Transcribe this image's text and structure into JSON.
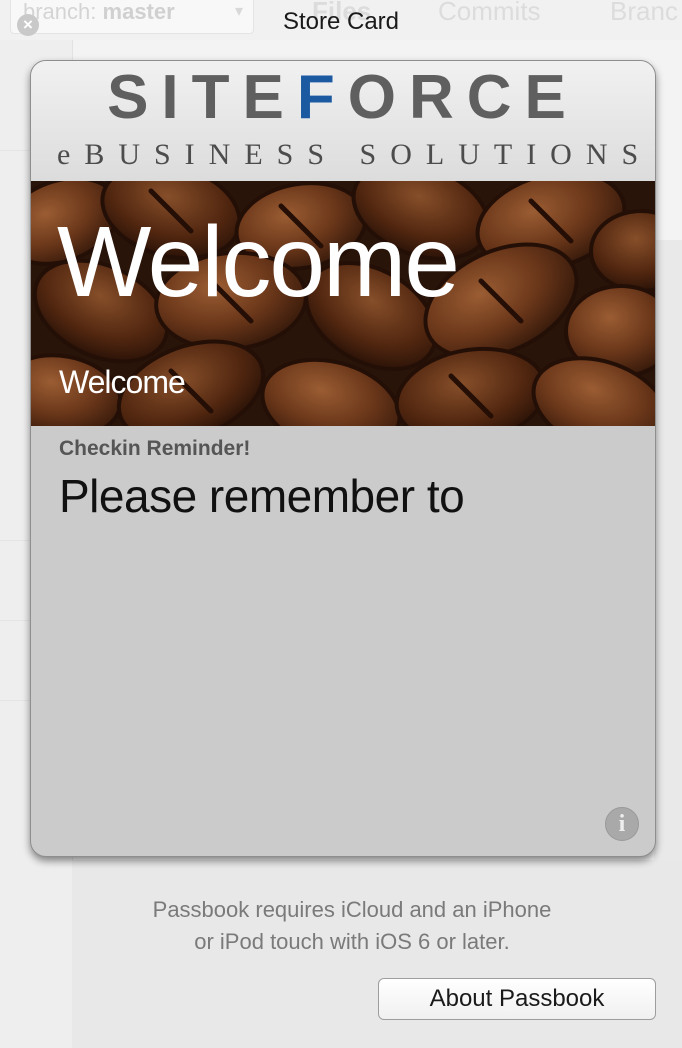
{
  "window": {
    "title": "Store Card",
    "close_icon": "close-icon"
  },
  "background_window": {
    "branch_label": "branch:",
    "branch_name": "master",
    "tabs": [
      "Files",
      "Commits",
      "Branc"
    ]
  },
  "pass": {
    "logo_text_left": "SITE",
    "logo_text_accent": "F",
    "logo_text_right": "ORCE",
    "logo_subtitle": "eBUSINESS SOLUTIONS",
    "primary_field": {
      "value": "Welcome",
      "label": "Welcome"
    },
    "secondary_field": {
      "label": "Checkin Reminder!",
      "value": "Please remember to"
    },
    "info_icon": "info-icon",
    "colors": {
      "card_background": "#cbcbcb",
      "logo_accent": "#1b5aa0",
      "logo_text": "#5f5f5f"
    }
  },
  "footer": {
    "note_line1": "Passbook requires iCloud and an iPhone",
    "note_line2": "or iPod touch with iOS 6 or later.",
    "about_button_label": "About Passbook"
  }
}
